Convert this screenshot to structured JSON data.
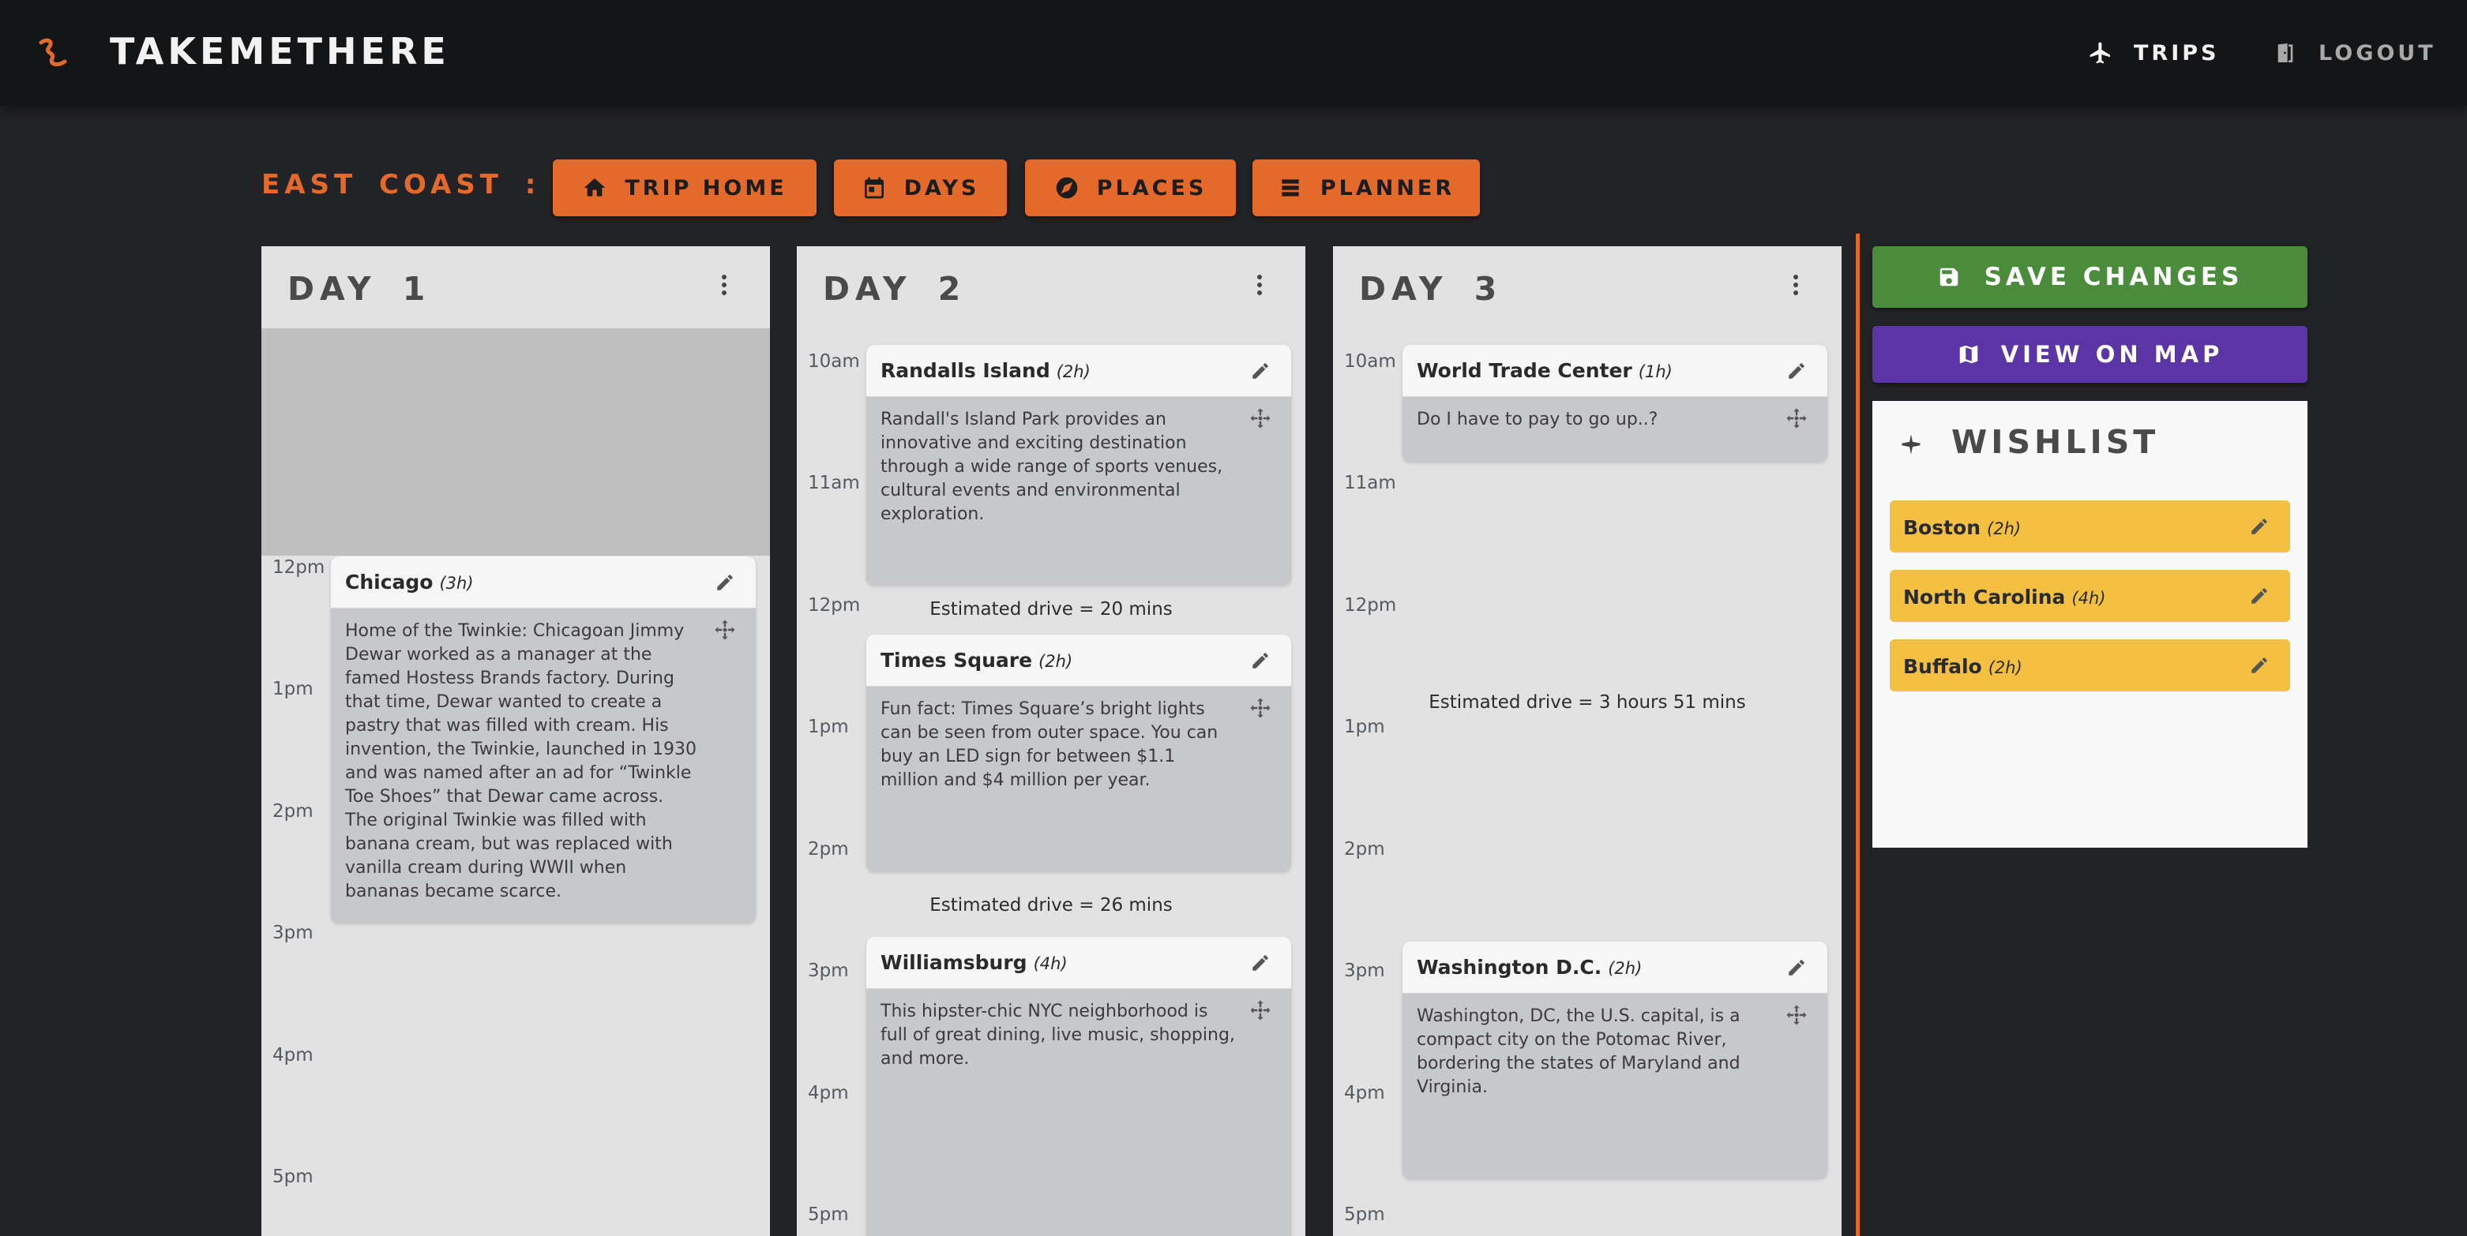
{
  "app": {
    "brand": "TAKEMETHERE"
  },
  "nav": {
    "trips_label": "TRIPS",
    "logout_label": "LOGOUT"
  },
  "trip": {
    "title": "EAST COAST :"
  },
  "tabs": [
    {
      "label": "TRIP HOME",
      "icon": "home-icon"
    },
    {
      "label": "DAYS",
      "icon": "calendar-icon"
    },
    {
      "label": "PLACES",
      "icon": "compass-icon"
    },
    {
      "label": "PLANNER",
      "icon": "planner-icon"
    }
  ],
  "days": [
    {
      "title": "DAY 1",
      "times": [
        "12pm",
        "1pm",
        "2pm",
        "3pm",
        "4pm",
        "5pm"
      ],
      "events": [
        {
          "name": "Chicago",
          "duration": "(3h)",
          "description": "Home of the Twinkie: Chicagoan Jimmy Dewar worked as a manager at the famed Hostess Brands factory. During that time, Dewar wanted to create a pastry that was filled with cream. His invention, the Twinkie, launched in 1930 and was named after an ad for “Twinkle Toe Shoes” that Dewar came across. The original Twinkie was filled with banana cream, but was replaced with vanilla cream during WWII when bananas became scarce."
        }
      ]
    },
    {
      "title": "DAY 2",
      "times": [
        "10am",
        "11am",
        "12pm",
        "1pm",
        "2pm",
        "3pm",
        "4pm",
        "5pm"
      ],
      "events": [
        {
          "name": "Randalls Island",
          "duration": "(2h)",
          "description": "Randall's Island Park provides an innovative and exciting destination through a wide range of sports venues, cultural events and environmental exploration."
        },
        {
          "name": "Times Square",
          "duration": "(2h)",
          "description": "Fun fact: Times Square’s bright lights can be seen from outer space. You can buy an LED sign for between $1.1 million and $4 million per year."
        },
        {
          "name": "Williamsburg",
          "duration": "(4h)",
          "description": "This hipster-chic NYC neighborhood is full of great dining, live music, shopping, and more."
        }
      ],
      "drives": [
        "Estimated drive = 20 mins",
        "Estimated drive = 26 mins"
      ]
    },
    {
      "title": "DAY 3",
      "times": [
        "10am",
        "11am",
        "12pm",
        "1pm",
        "2pm",
        "3pm",
        "4pm",
        "5pm"
      ],
      "events": [
        {
          "name": "World Trade Center",
          "duration": "(1h)",
          "description": "Do I have to pay to go up..?"
        },
        {
          "name": "Washington D.C.",
          "duration": "(2h)",
          "description": "Washington, DC, the U.S. capital, is a compact city on the Potomac River, bordering the states of Maryland and Virginia."
        }
      ],
      "drives": [
        "Estimated drive = 3 hours 51 mins"
      ]
    }
  ],
  "actions": {
    "save_label": "SAVE CHANGES",
    "map_label": "VIEW ON MAP"
  },
  "wishlist": {
    "title": "WISHLIST",
    "items": [
      {
        "name": "Boston",
        "duration": "(2h)"
      },
      {
        "name": "North Carolina",
        "duration": "(4h)"
      },
      {
        "name": "Buffalo",
        "duration": "(2h)"
      }
    ]
  },
  "colors": {
    "accent": "#e46a2c",
    "save": "#4b8c3c",
    "map": "#5b34a5",
    "wish_item": "#f4c042",
    "background": "#222327",
    "navbar": "#141517"
  }
}
